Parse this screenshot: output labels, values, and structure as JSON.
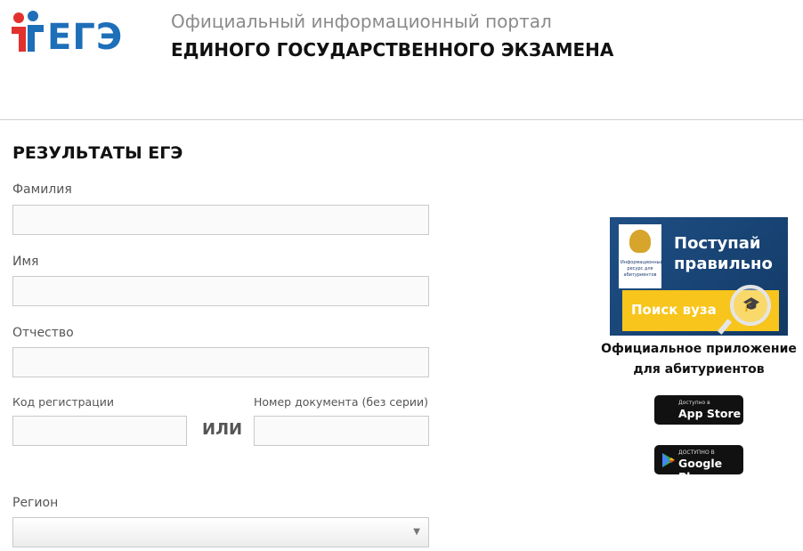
{
  "header": {
    "logo_text": "ЕГЭ",
    "portal_subtitle": "Официальный информационный портал",
    "portal_title": "ЕДИНОГО ГОСУДАРСТВЕННОГО ЭКЗАМЕНА"
  },
  "form": {
    "title": "РЕЗУЛЬТАТЫ ЕГЭ",
    "surname_label": "Фамилия",
    "name_label": "Имя",
    "patronymic_label": "Отчество",
    "reg_code_label": "Код регистрации",
    "or_label": "ИЛИ",
    "doc_number_label": "Номер документа (без серии)",
    "region_label": "Регион",
    "region_value": ""
  },
  "promo": {
    "crest_caption": "Информационный ресурс для абитуриентов",
    "slogan_line1": "Поступай",
    "slogan_line2": "правильно",
    "search_label": "Поиск вуза",
    "caption_line1": "Официальное приложение",
    "caption_line2": "для абитуриентов",
    "appstore_small": "Доступно в",
    "appstore_big": "App Store",
    "googleplay_small": "ДОСТУПНО В",
    "googleplay_big": "Google Play"
  },
  "colors": {
    "brand_blue": "#1d6fb8",
    "brand_red": "#e2312c",
    "banner_blue": "#1f4f85",
    "search_yellow": "#f7c51c"
  }
}
